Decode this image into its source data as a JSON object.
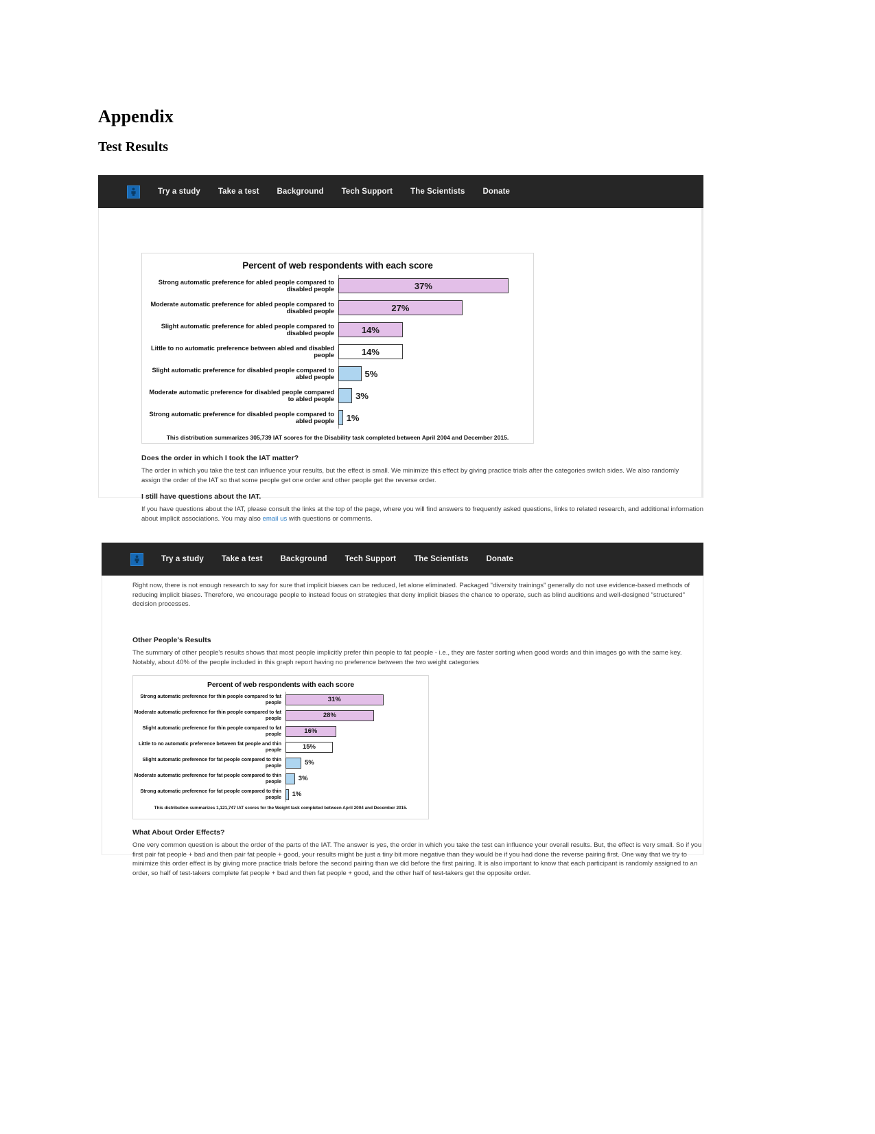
{
  "document": {
    "appendix_heading": "Appendix",
    "section_heading": "Test Results"
  },
  "nav": {
    "logo_name": "project-implicit-logo",
    "links": [
      "Try a study",
      "Take a test",
      "Background",
      "Tech Support",
      "The Scientists",
      "Donate"
    ]
  },
  "screenshot1": {
    "sections": [
      {
        "heading": "Does the order in which I took the IAT matter?",
        "paragraph": "The order in which you take the test can influence your results, but the effect is small. We minimize this effect by giving practice trials after the categories switch sides. We also randomly assign the order of the IAT so that some people get one order and other people get the reverse order."
      },
      {
        "heading": "I still have questions about the IAT.",
        "paragraph_before_link": "If you have questions about the IAT, please consult the links at the top of the page, where you will find answers to frequently asked questions, links to related research, and additional information about implicit associations. You may also ",
        "link_text": "email us",
        "paragraph_after_link": " with questions or comments."
      }
    ]
  },
  "screenshot2": {
    "intro_paragraph": "Right now, there is not enough research to say for sure that implicit biases can be reduced, let alone eliminated. Packaged \"diversity trainings\" generally do not use evidence-based methods of reducing implicit biases. Therefore, we encourage people to instead focus on strategies that deny implicit biases the chance to operate, such as blind auditions and well-designed \"structured\" decision processes.",
    "other_results_heading": "Other People's Results",
    "other_results_paragraph": "The summary of other people's results shows that most people implicitly prefer thin people to fat people - i.e., they are faster sorting when good words and thin images go with the same key. Notably, about 40% of the people included in this graph report having no preference between the two weight categories",
    "order_effects_heading": "What About Order Effects?",
    "order_effects_paragraph": "One very common question is about the order of the parts of the IAT. The answer is yes, the order in which you take the test can influence your overall results. But, the effect is very small. So if you first pair fat people + bad and then pair fat people + good, your results might be just a tiny bit more negative than they would be if you had done the reverse pairing first. One way that we try to minimize this order effect is by giving more practice trials before the second pairing than we did before the first pairing. It is also important to know that each participant is randomly assigned to an order, so half of test-takers complete fat people + bad and then fat people + good, and the other half of test-takers get the opposite order."
  },
  "chart_data": [
    {
      "type": "bar",
      "title": "Percent of web respondents with each score",
      "orientation": "horizontal",
      "xlabel": "",
      "ylabel": "",
      "xlim": [
        0,
        40
      ],
      "grid": false,
      "legend": "none",
      "note": "This distribution summarizes 305,739 IAT scores for the Disability task completed between April 2004 and December 2015.",
      "categories": [
        "Strong automatic preference for abled people compared to disabled people",
        "Moderate automatic preference for abled people compared to disabled people",
        "Slight automatic preference for abled people compared to disabled people",
        "Little to no automatic preference between abled and disabled people",
        "Slight automatic preference for disabled people compared to abled people",
        "Moderate automatic preference for disabled people compared to abled people",
        "Strong automatic preference for disabled people compared to abled people"
      ],
      "values": [
        37,
        27,
        14,
        14,
        5,
        3,
        1
      ],
      "value_labels": [
        "37%",
        "27%",
        "14%",
        "14%",
        "5%",
        "3%",
        "1%"
      ],
      "bar_colors": [
        "#e3bfe8",
        "#e3bfe8",
        "#e3bfe8",
        "#ffffff",
        "#aed5f0",
        "#aed5f0",
        "#aed5f0"
      ]
    },
    {
      "type": "bar",
      "title": "Percent of web respondents with each score",
      "orientation": "horizontal",
      "xlabel": "",
      "ylabel": "",
      "xlim": [
        0,
        40
      ],
      "grid": false,
      "legend": "none",
      "note": "This distribution summarizes 1,121,747 IAT scores for the Weight task completed between April 2004 and December 2015.",
      "categories": [
        "Strong automatic preference for thin people compared to fat people",
        "Moderate automatic preference for thin people compared to fat people",
        "Slight automatic preference for thin people compared to fat people",
        "Little to no automatic preference between fat people and thin people",
        "Slight automatic preference for fat people compared to thin people",
        "Moderate automatic preference for fat people compared to thin people",
        "Strong automatic preference for fat people compared to thin people"
      ],
      "values": [
        31,
        28,
        16,
        15,
        5,
        3,
        1
      ],
      "value_labels": [
        "31%",
        "28%",
        "16%",
        "15%",
        "5%",
        "3%",
        "1%"
      ],
      "bar_colors": [
        "#e3bfe8",
        "#e3bfe8",
        "#e3bfe8",
        "#ffffff",
        "#aed5f0",
        "#aed5f0",
        "#aed5f0"
      ]
    }
  ]
}
